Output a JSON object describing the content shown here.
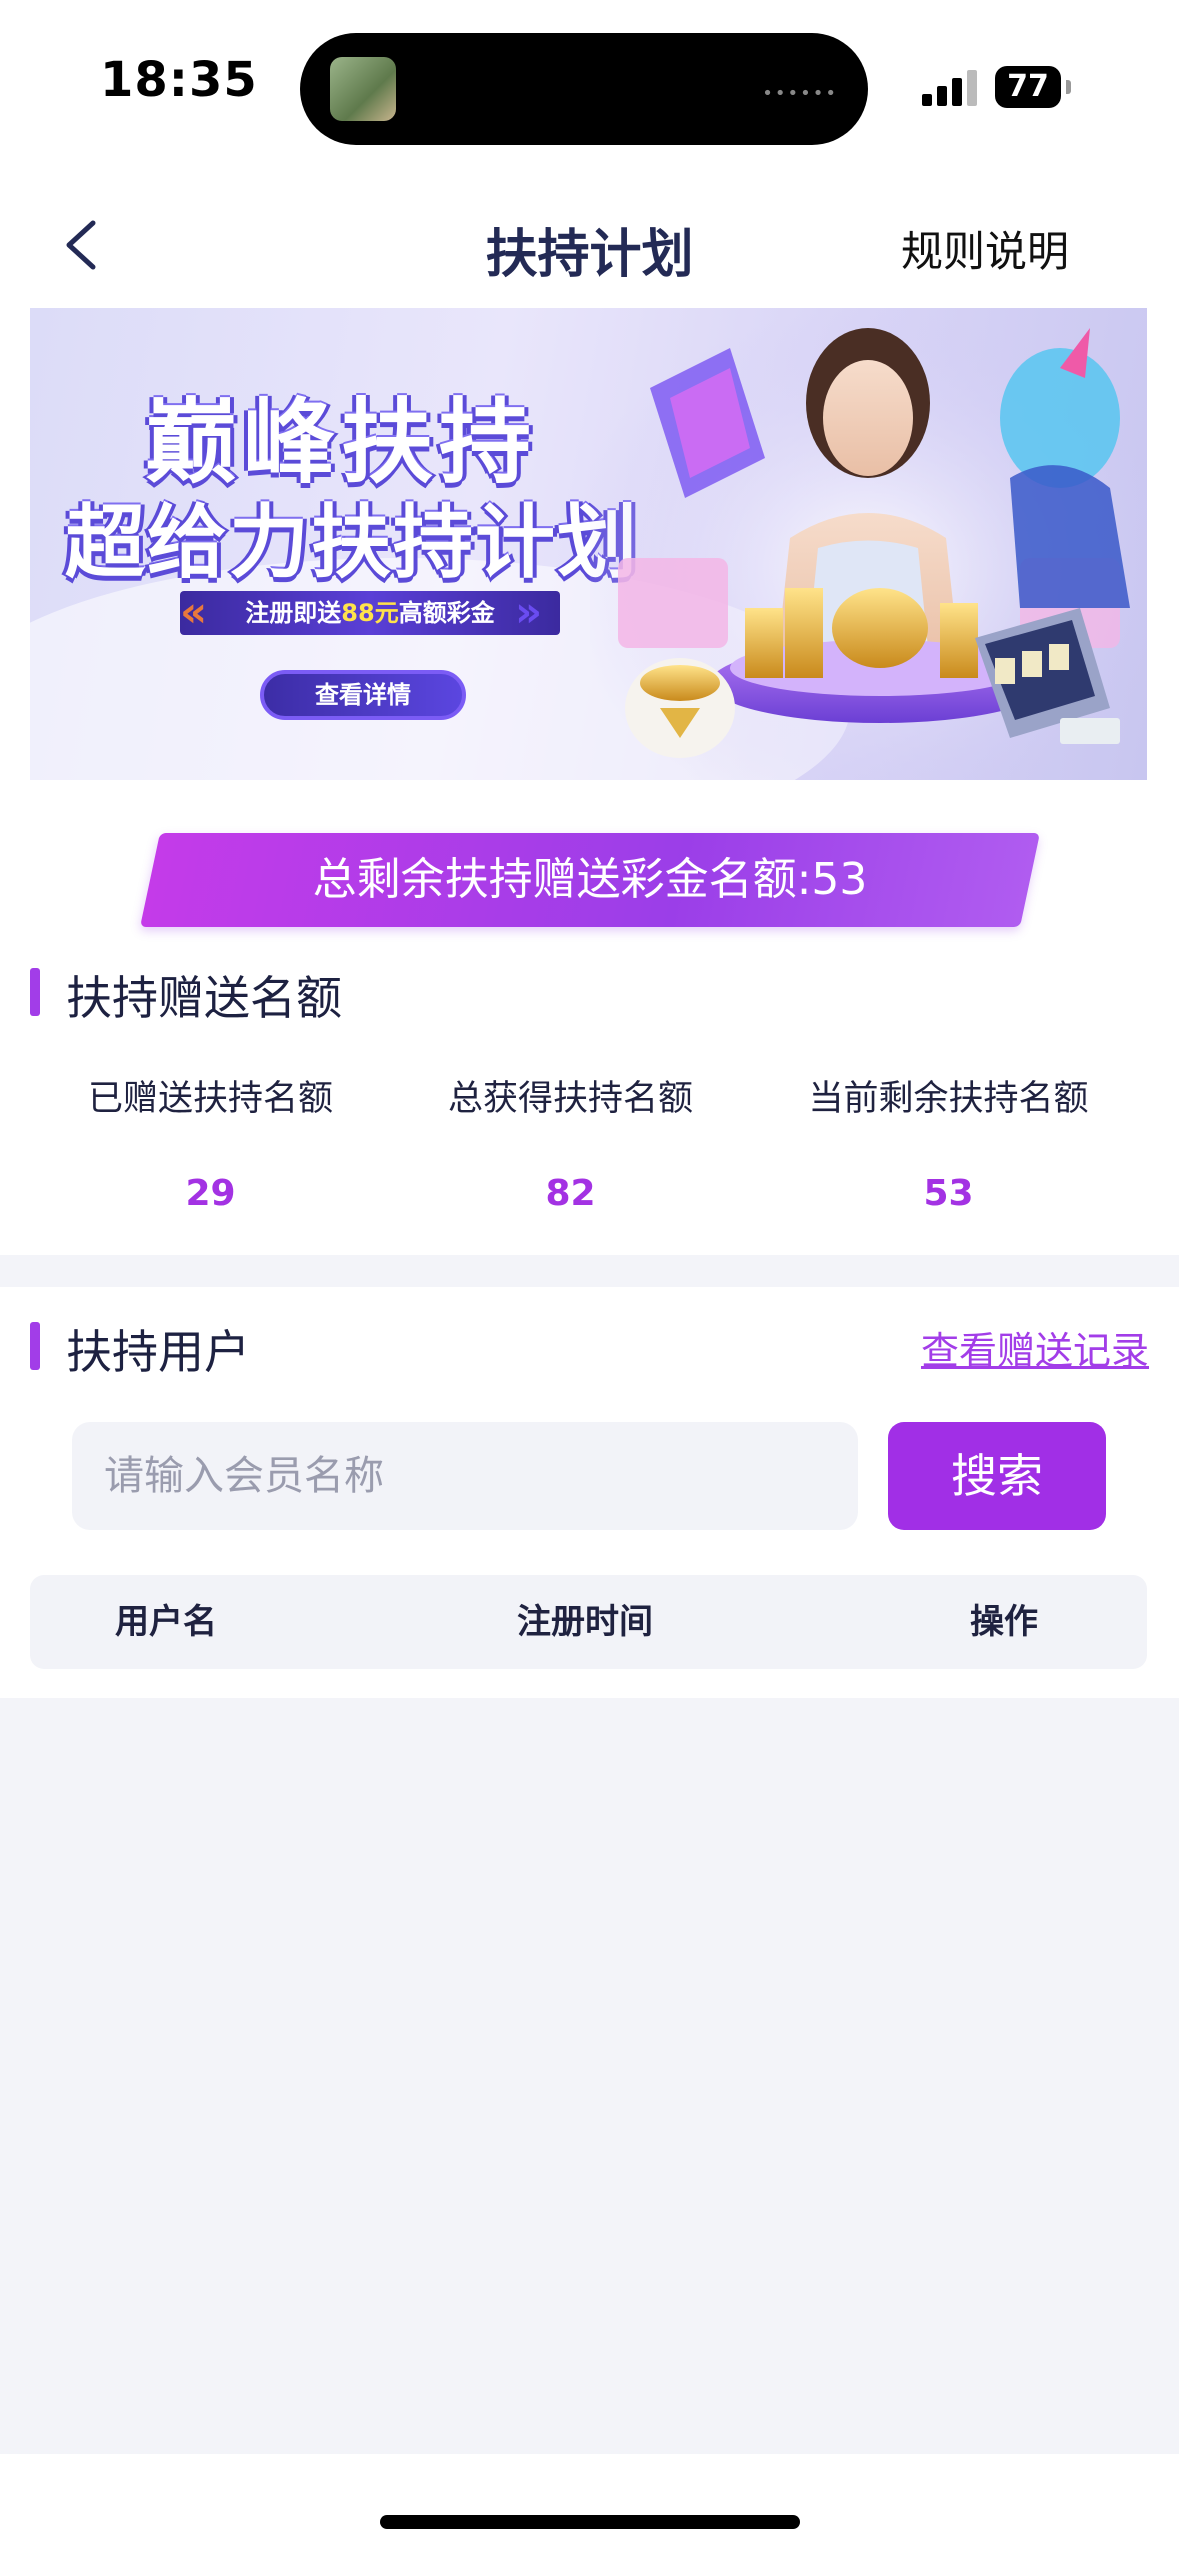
{
  "status": {
    "time": "18:35",
    "battery": "77"
  },
  "nav": {
    "title": "扶持计划",
    "rules": "规则说明"
  },
  "banner": {
    "title_line1": "巅峰扶持",
    "title_line2": "超给力扶持计划",
    "promo_prefix": "注册即送",
    "promo_amount": "88元",
    "promo_suffix": "高额彩金",
    "details_button": "查看详情"
  },
  "quota_banner": "总剩余扶持赠送彩金名额:53",
  "quota_section": {
    "title": "扶持赠送名额",
    "stats": [
      {
        "label": "已赠送扶持名额",
        "value": "29"
      },
      {
        "label": "总获得扶持名额",
        "value": "82"
      },
      {
        "label": "当前剩余扶持名额",
        "value": "53"
      }
    ]
  },
  "users_section": {
    "title": "扶持用户",
    "record_link": "查看赠送记录",
    "search_placeholder": "请输入会员名称",
    "search_button": "搜索",
    "table_headers": [
      "用户名",
      "注册时间",
      "操作"
    ]
  },
  "colors": {
    "accent": "#a12fe6",
    "nav_title": "#232a55"
  }
}
